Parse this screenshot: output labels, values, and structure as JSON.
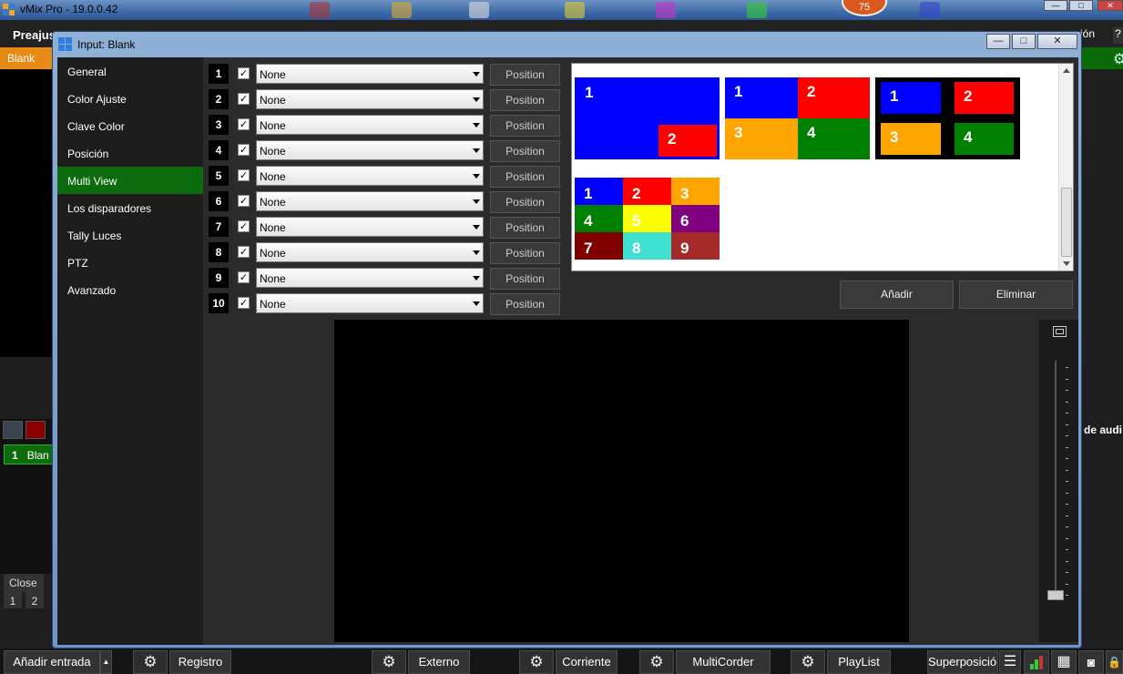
{
  "main": {
    "title": "vMix Pro - 19.0.0.42",
    "update_count": "75",
    "menu_left": "Preajus",
    "menu_right": "ción",
    "help": "?",
    "active_input_label": "Blank",
    "input_number": "1",
    "input_name": "Blan",
    "close_label": "Close",
    "small_numbers": [
      "1",
      "2"
    ],
    "right_label": "de audi"
  },
  "dialog": {
    "title": "Input: Blank",
    "sidebar": [
      "General",
      "Color Ajuste",
      "Clave Color",
      "Posición",
      "Multi View",
      "Los disparadores",
      "Tally Luces",
      "PTZ",
      "Avanzado"
    ],
    "active_index": 4,
    "rows": [
      {
        "num": "1",
        "value": "None",
        "button": "Position"
      },
      {
        "num": "2",
        "value": "None",
        "button": "Position"
      },
      {
        "num": "3",
        "value": "None",
        "button": "Position"
      },
      {
        "num": "4",
        "value": "None",
        "button": "Position"
      },
      {
        "num": "5",
        "value": "None",
        "button": "Position"
      },
      {
        "num": "6",
        "value": "None",
        "button": "Position"
      },
      {
        "num": "7",
        "value": "None",
        "button": "Position"
      },
      {
        "num": "8",
        "value": "None",
        "button": "Position"
      },
      {
        "num": "9",
        "value": "None",
        "button": "Position"
      },
      {
        "num": "10",
        "value": "None",
        "button": "Position"
      }
    ],
    "add_label": "Añadir",
    "remove_label": "Eliminar",
    "layouts": {
      "layout1": [
        "1",
        "2"
      ],
      "layout2": [
        "1",
        "2",
        "3",
        "4"
      ],
      "layout3": [
        "1",
        "2",
        "3",
        "4"
      ],
      "layout4": [
        "1",
        "2",
        "3",
        "4",
        "5",
        "6",
        "7",
        "8",
        "9"
      ]
    }
  },
  "bottom_bar": {
    "add_input": "Añadir entrada",
    "buttons": [
      "Registro",
      "Externo",
      "Corriente",
      "MultiCorder",
      "PlayList"
    ],
    "overlay": "Superposición"
  },
  "colors": {
    "blue": "#0000ff",
    "red": "#ff0000",
    "orange": "#ffa500",
    "green": "#008000",
    "yellow": "#ffff00",
    "purple": "#800080",
    "maroon": "#800000",
    "turquoise": "#40e0d0",
    "brown": "#a52a2a",
    "active_green": "#0c6b0c"
  }
}
